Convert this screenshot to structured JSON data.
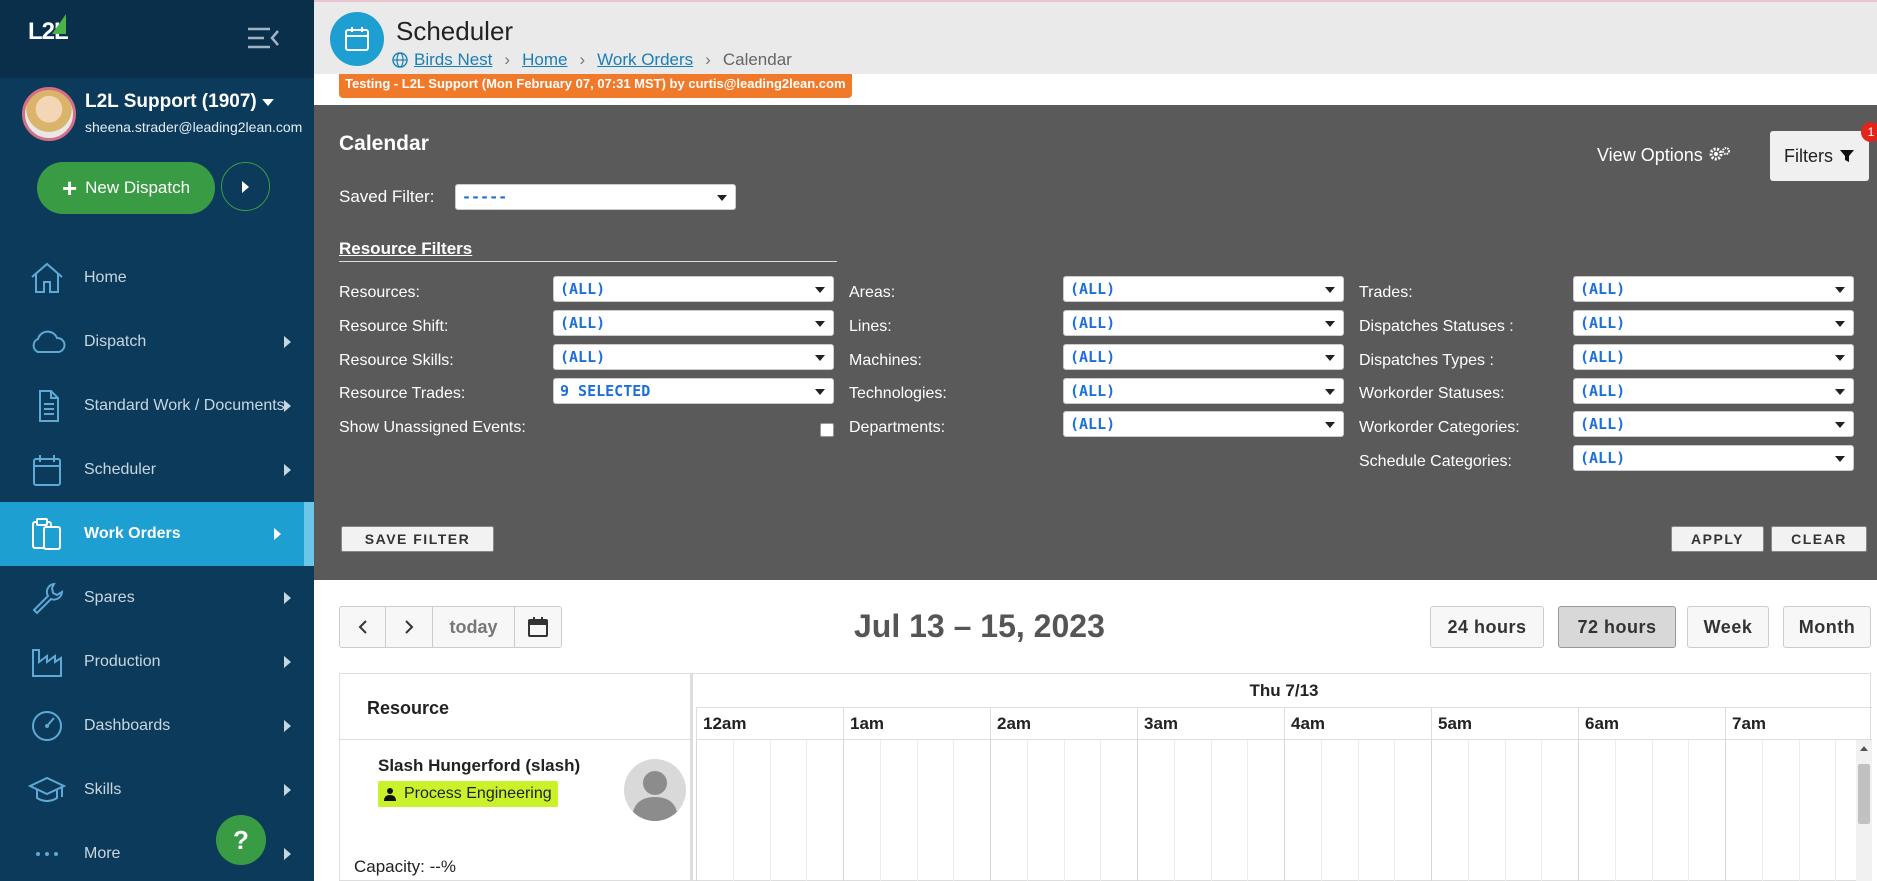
{
  "sidebar": {
    "logo": "L2L",
    "user_name": "L2L Support (1907)",
    "user_email": "sheena.strader@leading2lean.com",
    "new_dispatch_label": "New Dispatch",
    "help_label": "?",
    "items": [
      {
        "label": "Home",
        "icon": "home-icon",
        "has_arrow": false
      },
      {
        "label": "Dispatch",
        "icon": "cloud-icon",
        "has_arrow": true
      },
      {
        "label": "Standard Work / Documents",
        "icon": "document-icon",
        "has_arrow": true
      },
      {
        "label": "Scheduler",
        "icon": "calendar-icon",
        "has_arrow": true
      },
      {
        "label": "Work Orders",
        "icon": "clipboard-icon",
        "has_arrow": true,
        "active": true
      },
      {
        "label": "Spares",
        "icon": "wrench-icon",
        "has_arrow": true
      },
      {
        "label": "Production",
        "icon": "factory-icon",
        "has_arrow": true
      },
      {
        "label": "Dashboards",
        "icon": "gauge-icon",
        "has_arrow": true
      },
      {
        "label": "Skills",
        "icon": "graduation-cap-icon",
        "has_arrow": true
      },
      {
        "label": "More",
        "icon": "more-dots-icon",
        "has_arrow": true
      }
    ]
  },
  "header": {
    "title": "Scheduler",
    "breadcrumb": {
      "site": "Birds Nest",
      "home": "Home",
      "work_orders": "Work Orders",
      "current": "Calendar"
    },
    "banner": "Testing - L2L Support (Mon February 07, 07:31 MST) by curtis@leading2lean.com"
  },
  "filters": {
    "title": "Calendar",
    "saved_filter_label": "Saved Filter:",
    "saved_filter_value": "-----",
    "view_options_label": "View Options",
    "filters_button_label": "Filters",
    "filters_badge": "1",
    "resource_filters_title": "Resource Filters",
    "left": [
      {
        "label": "Resources:",
        "value": "(ALL)"
      },
      {
        "label": "Resource Shift:",
        "value": "(ALL)"
      },
      {
        "label": "Resource Skills:",
        "value": "(ALL)"
      },
      {
        "label": "Resource Trades:",
        "value": "9 SELECTED"
      }
    ],
    "show_unassigned_label": "Show Unassigned Events:",
    "show_unassigned_checked": false,
    "middle": [
      {
        "label": "Areas:",
        "value": "(ALL)"
      },
      {
        "label": "Lines:",
        "value": "(ALL)"
      },
      {
        "label": "Machines:",
        "value": "(ALL)"
      },
      {
        "label": "Technologies:",
        "value": "(ALL)"
      },
      {
        "label": "Departments:",
        "value": "(ALL)"
      }
    ],
    "right": [
      {
        "label": "Trades:",
        "value": "(ALL)"
      },
      {
        "label": "Dispatches Statuses :",
        "value": "(ALL)"
      },
      {
        "label": "Dispatches Types :",
        "value": "(ALL)"
      },
      {
        "label": "Workorder Statuses:",
        "value": "(ALL)"
      },
      {
        "label": "Workorder Categories:",
        "value": "(ALL)"
      },
      {
        "label": "Schedule Categories:",
        "value": "(ALL)"
      }
    ],
    "save_filter_label": "SAVE FILTER",
    "apply_label": "APPLY",
    "clear_label": "CLEAR"
  },
  "calendar": {
    "today_label": "today",
    "range_title": "Jul 13 – 15, 2023",
    "views": [
      "24 hours",
      "72 hours",
      "Week",
      "Month"
    ],
    "active_view": "72 hours",
    "resource_header": "Resource",
    "day_header": "Thu 7/13",
    "hours": [
      "12am",
      "1am",
      "2am",
      "3am",
      "4am",
      "5am",
      "6am",
      "7am"
    ],
    "resource": {
      "name": "Slash Hungerford (slash)",
      "tag": "Process Engineering",
      "tag_color": "#c9f22a",
      "capacity": "Capacity: --%"
    }
  },
  "colors": {
    "sidebar_bg": "#0c3a5a",
    "accent_blue": "#1e9fd2",
    "accent_green": "#3a9b45",
    "banner_orange": "#f07a2a",
    "filter_panel_bg": "#5a5a5a"
  }
}
